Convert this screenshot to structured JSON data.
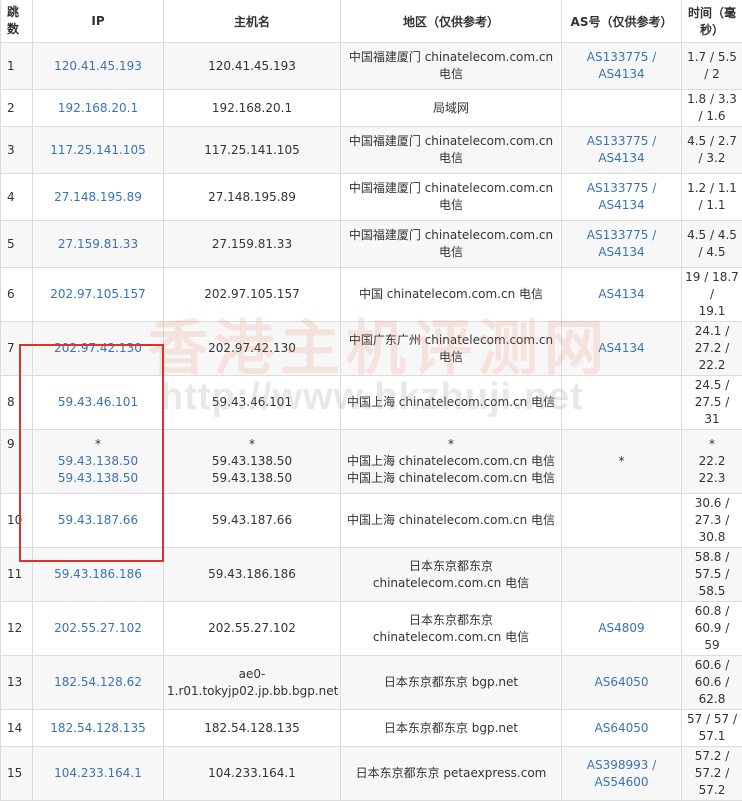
{
  "headers": {
    "hop": "跳数",
    "ip": "IP",
    "host": "主机名",
    "loc": "地区（仅供参考）",
    "as": "AS号（仅供参考）",
    "time": "时间（毫秒）"
  },
  "rows": [
    {
      "hop": "1",
      "ips": [
        "120.41.45.193"
      ],
      "hosts": [
        "120.41.45.193"
      ],
      "locs": [
        "中国福建厦门 chinatelecom.com.cn",
        "电信"
      ],
      "as": [
        "AS133775 /",
        "AS4134"
      ],
      "time": [
        "1.7 / 5.5 / 2"
      ]
    },
    {
      "hop": "2",
      "ips": [
        "192.168.20.1"
      ],
      "hosts": [
        "192.168.20.1"
      ],
      "locs": [
        "局域网"
      ],
      "as": [],
      "time": [
        "1.8 / 3.3 / 1.6"
      ]
    },
    {
      "hop": "3",
      "ips": [
        "117.25.141.105"
      ],
      "hosts": [
        "117.25.141.105"
      ],
      "locs": [
        "中国福建厦门 chinatelecom.com.cn",
        "电信"
      ],
      "as": [
        "AS133775 /",
        "AS4134"
      ],
      "time": [
        "4.5 / 2.7 / 3.2"
      ]
    },
    {
      "hop": "4",
      "ips": [
        "27.148.195.89"
      ],
      "hosts": [
        "27.148.195.89"
      ],
      "locs": [
        "中国福建厦门 chinatelecom.com.cn",
        "电信"
      ],
      "as": [
        "AS133775 /",
        "AS4134"
      ],
      "time": [
        "1.2 / 1.1 / 1.1"
      ]
    },
    {
      "hop": "5",
      "ips": [
        "27.159.81.33"
      ],
      "hosts": [
        "27.159.81.33"
      ],
      "locs": [
        "中国福建厦门 chinatelecom.com.cn",
        "电信"
      ],
      "as": [
        "AS133775 /",
        "AS4134"
      ],
      "time": [
        "4.5 / 4.5 / 4.5"
      ]
    },
    {
      "hop": "6",
      "ips": [
        "202.97.105.157"
      ],
      "hosts": [
        "202.97.105.157"
      ],
      "locs": [
        "中国 chinatelecom.com.cn 电信"
      ],
      "as": [
        "AS4134"
      ],
      "time": [
        "19 / 18.7 /",
        "19.1"
      ]
    },
    {
      "hop": "7",
      "ips": [
        "202.97.42.130"
      ],
      "hosts": [
        "202.97.42.130"
      ],
      "locs": [
        "中国广东广州 chinatelecom.com.cn",
        "电信"
      ],
      "as": [
        "AS4134"
      ],
      "time": [
        "24.1 / 27.2 /",
        "22.2"
      ]
    },
    {
      "hop": "8",
      "ips": [
        "59.43.46.101"
      ],
      "hosts": [
        "59.43.46.101"
      ],
      "locs": [
        "中国上海 chinatelecom.com.cn 电信"
      ],
      "as": [],
      "time": [
        "24.5 / 27.5 /",
        "31"
      ]
    },
    {
      "hop": "9",
      "ips": [
        "*",
        "59.43.138.50",
        "59.43.138.50"
      ],
      "hosts": [
        "*",
        "59.43.138.50",
        "59.43.138.50"
      ],
      "locs": [
        "*",
        "中国上海 chinatelecom.com.cn 电信",
        "中国上海 chinatelecom.com.cn 电信"
      ],
      "as": [
        "*"
      ],
      "time": [
        "*",
        "22.2",
        "22.3"
      ]
    },
    {
      "hop": "10",
      "ips": [
        "59.43.187.66"
      ],
      "hosts": [
        "59.43.187.66"
      ],
      "locs": [
        "中国上海 chinatelecom.com.cn 电信"
      ],
      "as": [],
      "time": [
        "30.6 / 27.3 /",
        "30.8"
      ]
    },
    {
      "hop": "11",
      "ips": [
        "59.43.186.186"
      ],
      "hosts": [
        "59.43.186.186"
      ],
      "locs": [
        "日本东京都东京",
        "chinatelecom.com.cn 电信"
      ],
      "as": [],
      "time": [
        "58.8 / 57.5 /",
        "58.5"
      ]
    },
    {
      "hop": "12",
      "ips": [
        "202.55.27.102"
      ],
      "hosts": [
        "202.55.27.102"
      ],
      "locs": [
        "日本东京都东京",
        "chinatelecom.com.cn 电信"
      ],
      "as": [
        "AS4809"
      ],
      "time": [
        "60.8 / 60.9 /",
        "59"
      ]
    },
    {
      "hop": "13",
      "ips": [
        "182.54.128.62"
      ],
      "hosts": [
        "ae0-",
        "1.r01.tokyjp02.jp.bb.bgp.net"
      ],
      "locs": [
        "日本东京都东京 bgp.net"
      ],
      "as": [
        "AS64050"
      ],
      "time": [
        "60.6 / 60.6 /",
        "62.8"
      ]
    },
    {
      "hop": "14",
      "ips": [
        "182.54.128.135"
      ],
      "hosts": [
        "182.54.128.135"
      ],
      "locs": [
        "日本东京都东京 bgp.net"
      ],
      "as": [
        "AS64050"
      ],
      "time": [
        "57 / 57 / 57.1"
      ]
    },
    {
      "hop": "15",
      "ips": [
        "104.233.164.1"
      ],
      "hosts": [
        "104.233.164.1"
      ],
      "locs": [
        "日本东京都东京 petaexpress.com"
      ],
      "as": [
        "AS398993 /",
        "AS54600"
      ],
      "time": [
        "57.2 / 57.2 /",
        "57.2"
      ]
    }
  ],
  "watermark": {
    "text": "香港主机评测网",
    "url": "http://www.hkzhuji.net"
  },
  "colors": {
    "link": "#3a73b5",
    "highlight_box": "#e0302a",
    "alt_row": "#f7f7f7"
  }
}
